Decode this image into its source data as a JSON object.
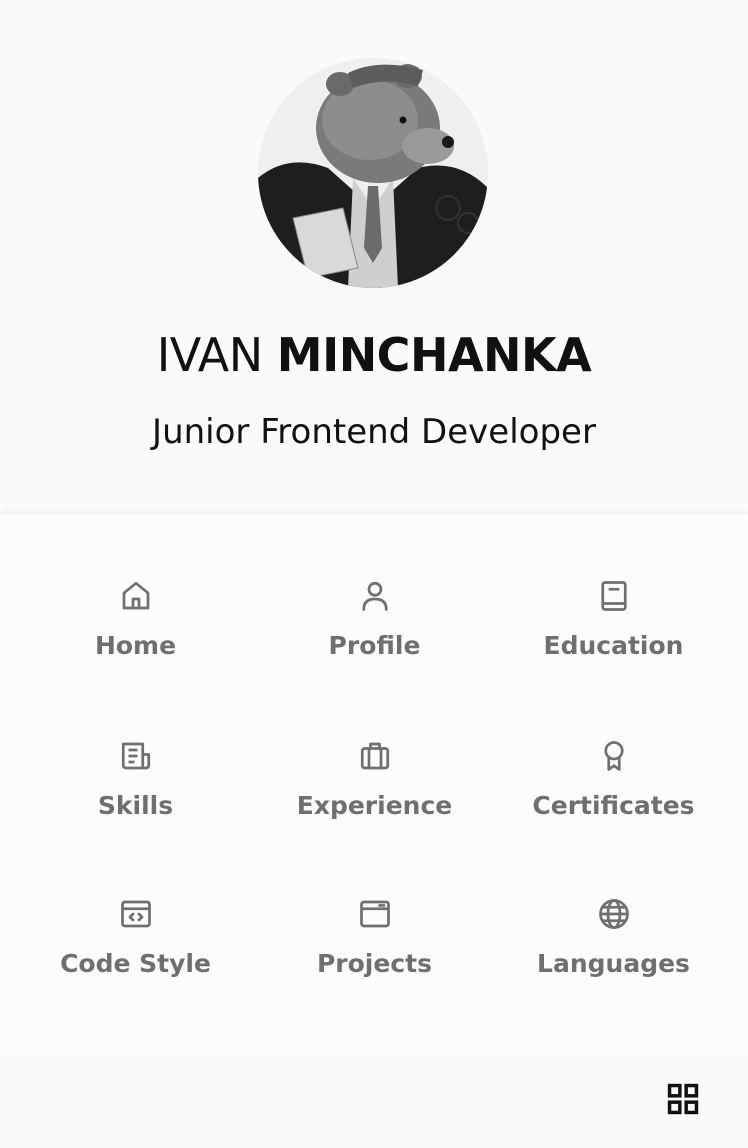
{
  "profile": {
    "first_name": "IVAN",
    "last_name": "MINCHANKA",
    "role": "Junior Frontend Developer"
  },
  "menu": {
    "items": [
      {
        "label": "Home",
        "icon": "home-icon"
      },
      {
        "label": "Profile",
        "icon": "user-icon"
      },
      {
        "label": "Education",
        "icon": "book-icon"
      },
      {
        "label": "Skills",
        "icon": "newspaper-icon"
      },
      {
        "label": "Experience",
        "icon": "briefcase-icon"
      },
      {
        "label": "Certificates",
        "icon": "award-icon"
      },
      {
        "label": "Code Style",
        "icon": "code-window-icon"
      },
      {
        "label": "Projects",
        "icon": "browser-window-icon"
      },
      {
        "label": "Languages",
        "icon": "globe-icon"
      }
    ]
  },
  "bottom_bar": {
    "menu_toggle_icon": "grid-icon"
  },
  "colors": {
    "background": "#fafafa",
    "menu_label": "#6f6f6f",
    "icon_stroke": "#6f6f6f",
    "text": "#111111"
  }
}
